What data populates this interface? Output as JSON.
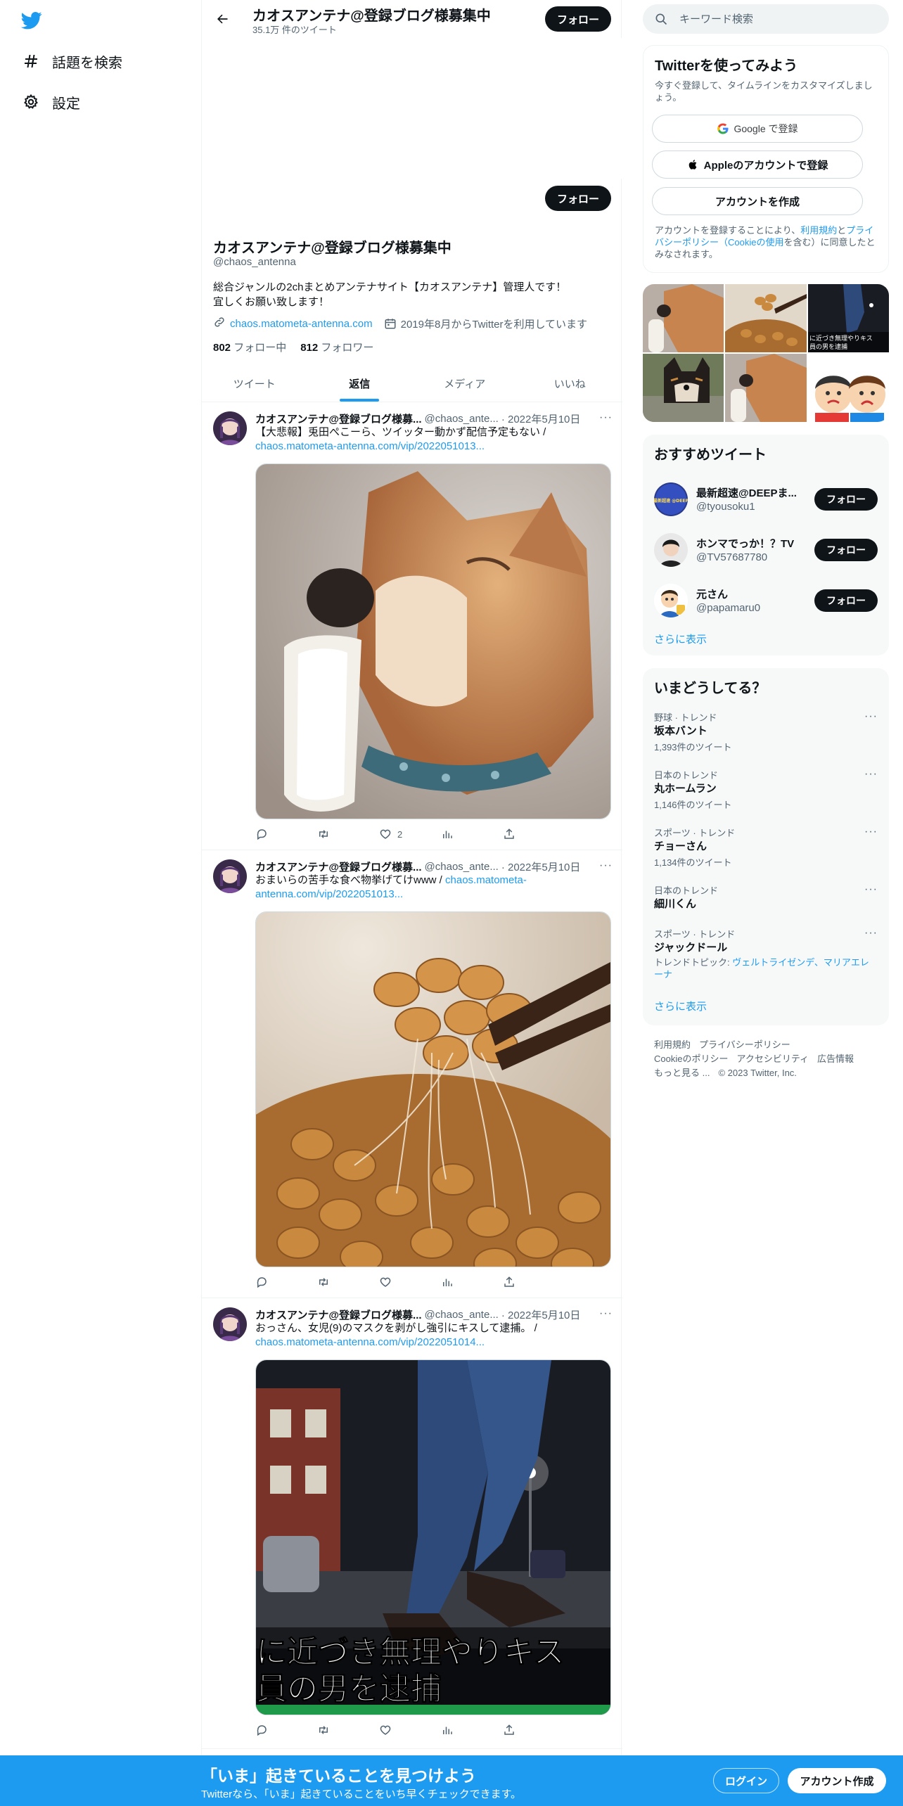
{
  "colors": {
    "accent": "#1d9bf0",
    "text": "#0f1419",
    "muted": "#536471",
    "follow_bg": "#0f1419"
  },
  "nav": {
    "logo_icon": "twitter-bird-icon",
    "items": [
      {
        "label": "話題を検索",
        "icon": "hashtag-icon"
      },
      {
        "label": "設定",
        "icon": "gear-icon"
      }
    ]
  },
  "header": {
    "name": "カオスアンテナ@登録ブログ様募集中",
    "tweet_count": "35.1万 件のツイート",
    "follow_label": "フォロー"
  },
  "profile": {
    "follow_label": "フォロー",
    "name": "カオスアンテナ@登録ブログ様募集中",
    "handle": "@chaos_antenna",
    "bio_line1": "総合ジャンルの2chまとめアンテナサイト【カオスアンテナ】管理人です！",
    "bio_line2": "宜しくお願い致します！",
    "link": "chaos.matometa-antenna.com",
    "joined": "2019年8月からTwitterを利用しています",
    "following_count": "802",
    "following_label": "フォロー中",
    "followers_count": "812",
    "followers_label": "フォロワー"
  },
  "tabs": [
    {
      "label": "ツイート",
      "active": false
    },
    {
      "label": "返信",
      "active": true
    },
    {
      "label": "メディア",
      "active": false
    },
    {
      "label": "いいね",
      "active": false
    }
  ],
  "tweets": [
    {
      "name": "カオスアンテナ@登録ブログ様募...",
      "handle": "@chaos_ante...",
      "date": "· 2022年5月10日",
      "more": "···",
      "text": "【大悲報】兎田ぺこーら、ツイッター動かず配信予定もない /",
      "link": "chaos.matometa-antenna.com/vip/2022051013...",
      "image": "shiba-dog-eating-popsicle",
      "likes": "2"
    },
    {
      "name": "カオスアンテナ@登録ブログ様募...",
      "handle": "@chaos_ante...",
      "date": "· 2022年5月10日",
      "more": "···",
      "text": "おまいらの苦手な食べ物挙げてけwww /",
      "link": "chaos.matometa-antenna.com/vip/2022051013...",
      "image": "natto-with-chopsticks",
      "likes": ""
    },
    {
      "name": "カオスアンテナ@登録ブログ様募...",
      "handle": "@chaos_ante...",
      "date": "· 2022年5月10日",
      "more": "···",
      "text": "おっさん、女児(9)のマスクを剥がし強引にキスして逮捕。 /",
      "link": "chaos.matometa-antenna.com/vip/2022051014...",
      "image": "news-thumbnail-legs-street",
      "overlay_line1": "に近づき無理やりキス",
      "overlay_line2": "員の男を逮捕",
      "likes": ""
    }
  ],
  "search": {
    "placeholder": "キーワード検索"
  },
  "signup": {
    "title": "Twitterを使ってみよう",
    "subtitle": "今すぐ登録して、タイムラインをカスタマイズしましょう。",
    "google_label": "Google で登録",
    "apple_label": "Appleのアカウントで登録",
    "create_label": "アカウントを作成",
    "terms_prefix": "アカウントを登録することにより、",
    "terms_link1": "利用規約",
    "terms_and": "と",
    "terms_link2": "プライバシーポリシー",
    "terms_paren_open": "（",
    "terms_link3": "Cookieの使用",
    "terms_suffix": "を含む）に同意したとみなされます。"
  },
  "photo_grid": {
    "thumb3_text1": "に近づき無理やりキス",
    "thumb3_text2": "員の男を逮捕"
  },
  "recommended": {
    "title": "おすすめツイート",
    "items": [
      {
        "name": "最新超速@DEEPま...",
        "handle": "@tyousoku1",
        "follow_label": "フォロー",
        "avatar_text": "最新超速 @DEEP"
      },
      {
        "name": "ホンマでっか！？TV",
        "handle": "@TV57687780",
        "follow_label": "フォロー"
      },
      {
        "name": "元さん",
        "handle": "@papamaru0",
        "follow_label": "フォロー"
      }
    ],
    "more_label": "さらに表示"
  },
  "trends": {
    "title": "いまどうしてる？",
    "items": [
      {
        "category": "野球 · トレンド",
        "name": "坂本バント",
        "count": "1,393件のツイート"
      },
      {
        "category": "日本のトレンド",
        "name": "丸ホームラン",
        "count": "1,146件のツイート"
      },
      {
        "category": "スポーツ · トレンド",
        "name": "チョーさん",
        "count": "1,134件のツイート"
      },
      {
        "category": "日本のトレンド",
        "name": "細川くん",
        "count": ""
      },
      {
        "category": "スポーツ · トレンド",
        "name": "ジャックドール",
        "topic_prefix": "トレンドトピック: ",
        "topic_link1": "ヴェルトライゼンデ",
        "topic_sep": "、",
        "topic_link2": "マリアエレーナ"
      }
    ],
    "more_label": "さらに表示"
  },
  "footer": {
    "terms": "利用規約",
    "privacy": "プライバシーポリシー",
    "cookies": "Cookieのポリシー",
    "accessibility": "アクセシビリティ",
    "ads": "広告情報",
    "more": "もっと見る ...",
    "copyright": "© 2023 Twitter, Inc."
  },
  "bottom_bar": {
    "title": "「いま」起きていることを見つけよう",
    "subtitle": "Twitterなら、「いま」起きていることをいち早くチェックできます。",
    "login_label": "ログイン",
    "create_label": "アカウント作成"
  }
}
